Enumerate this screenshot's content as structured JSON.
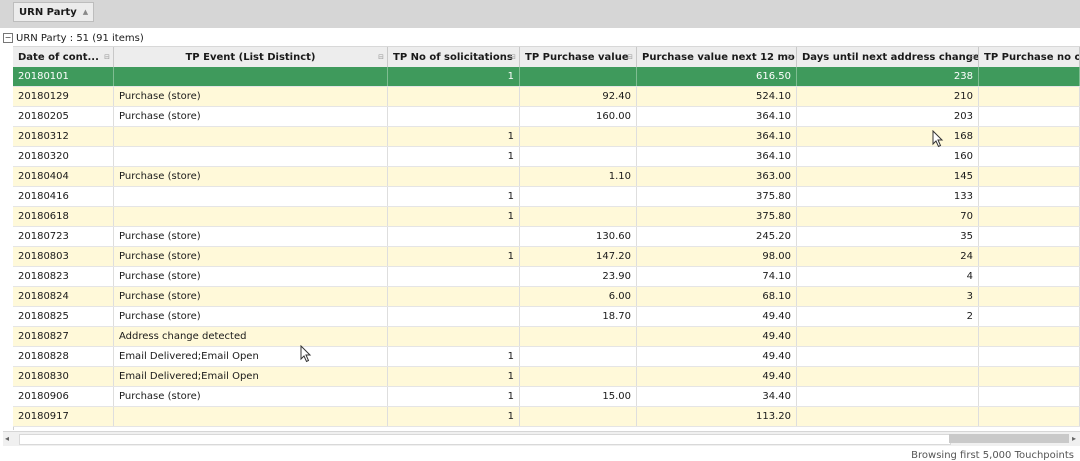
{
  "group_panel": {
    "chip_label": "URN Party"
  },
  "group_row": {
    "text": "URN Party : 51 (91 items)",
    "expander": "−"
  },
  "columns": [
    "Date of cont...",
    "TP Event (List Distinct)",
    "TP No of solicitations",
    "TP Purchase value",
    "Purchase value next 12 mo",
    "Days until next address change",
    "TP Purchase no of"
  ],
  "rows": [
    [
      "20180101",
      "",
      "1",
      "",
      "616.50",
      "238",
      ""
    ],
    [
      "20180129",
      "Purchase (store)",
      "",
      "92.40",
      "524.10",
      "210",
      ""
    ],
    [
      "20180205",
      "Purchase (store)",
      "",
      "160.00",
      "364.10",
      "203",
      ""
    ],
    [
      "20180312",
      "",
      "1",
      "",
      "364.10",
      "168",
      ""
    ],
    [
      "20180320",
      "",
      "1",
      "",
      "364.10",
      "160",
      ""
    ],
    [
      "20180404",
      "Purchase (store)",
      "",
      "1.10",
      "363.00",
      "145",
      ""
    ],
    [
      "20180416",
      "",
      "1",
      "",
      "375.80",
      "133",
      ""
    ],
    [
      "20180618",
      "",
      "1",
      "",
      "375.80",
      "70",
      ""
    ],
    [
      "20180723",
      "Purchase (store)",
      "",
      "130.60",
      "245.20",
      "35",
      ""
    ],
    [
      "20180803",
      "Purchase (store)",
      "1",
      "147.20",
      "98.00",
      "24",
      ""
    ],
    [
      "20180823",
      "Purchase (store)",
      "",
      "23.90",
      "74.10",
      "4",
      ""
    ],
    [
      "20180824",
      "Purchase (store)",
      "",
      "6.00",
      "68.10",
      "3",
      ""
    ],
    [
      "20180825",
      "Purchase (store)",
      "",
      "18.70",
      "49.40",
      "2",
      ""
    ],
    [
      "20180827",
      "Address change detected",
      "",
      "",
      "49.40",
      "",
      ""
    ],
    [
      "20180828",
      "Email Delivered;Email Open",
      "1",
      "",
      "49.40",
      "",
      ""
    ],
    [
      "20180830",
      "Email Delivered;Email Open",
      "1",
      "",
      "49.40",
      "",
      ""
    ],
    [
      "20180906",
      "Purchase (store)",
      "1",
      "15.00",
      "34.40",
      "",
      ""
    ],
    [
      "20180917",
      "",
      "1",
      "",
      "113.20",
      "",
      ""
    ]
  ],
  "status": {
    "text": "Browsing first 5,000 Touchpoints"
  },
  "colors": {
    "selected_row": "#3f9a5c",
    "alt_row": "#fff9d9",
    "header_bg": "#ededed"
  }
}
